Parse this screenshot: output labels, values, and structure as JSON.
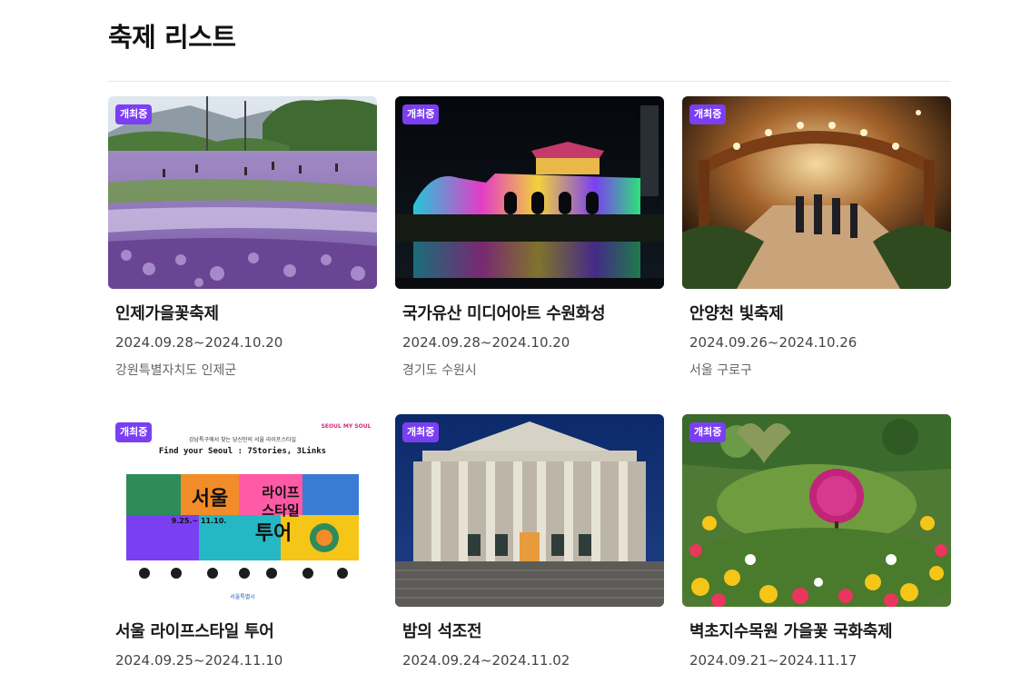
{
  "page": {
    "title": "축제 리스트"
  },
  "badge_color": "#7b3ff2",
  "festivals": [
    {
      "badge": "개최중",
      "title": "인제가을꽃축제",
      "date": "2024.09.28~2024.10.20",
      "location": "강원특별자치도 인제군",
      "image": "purple-flower-field-photo"
    },
    {
      "badge": "개최중",
      "title": "국가유산 미디어아트 수원화성",
      "date": "2024.09.28~2024.10.20",
      "location": "경기도 수원시",
      "image": "night-fortress-projection-photo"
    },
    {
      "badge": "개최중",
      "title": "안양천 빛축제",
      "date": "2024.09.26~2024.10.26",
      "location": "서울 구로구",
      "image": "lantern-tunnel-walkway-photo"
    },
    {
      "badge": "개최중",
      "title": "서울 라이프스타일 투어",
      "date": "2024.09.25~2024.11.10",
      "location": "",
      "image": "lifestyle-tour-poster",
      "poster": {
        "top_text": "강남특구에서 찾는 당신만의 서울 라이프스타일",
        "english_title": "Find your Seoul : 7Stories, 3Links",
        "logo": "SEOUL MY SOUL",
        "main_word_1": "서울",
        "main_word_2": "라이프",
        "main_word_3": "스타일",
        "main_word_4": "투어",
        "dates": "9.25.~ 11.10.",
        "footer": "서울특별시"
      }
    },
    {
      "badge": "개최중",
      "title": "밤의 석조전",
      "date": "2024.09.24~2024.11.02",
      "location": "",
      "image": "stone-palace-night-photo"
    },
    {
      "badge": "개최중",
      "title": "벽초지수목원 가을꽃 국화축제",
      "date": "2024.09.21~2024.11.17",
      "location": "",
      "image": "chrysanthemum-garden-photo"
    }
  ]
}
